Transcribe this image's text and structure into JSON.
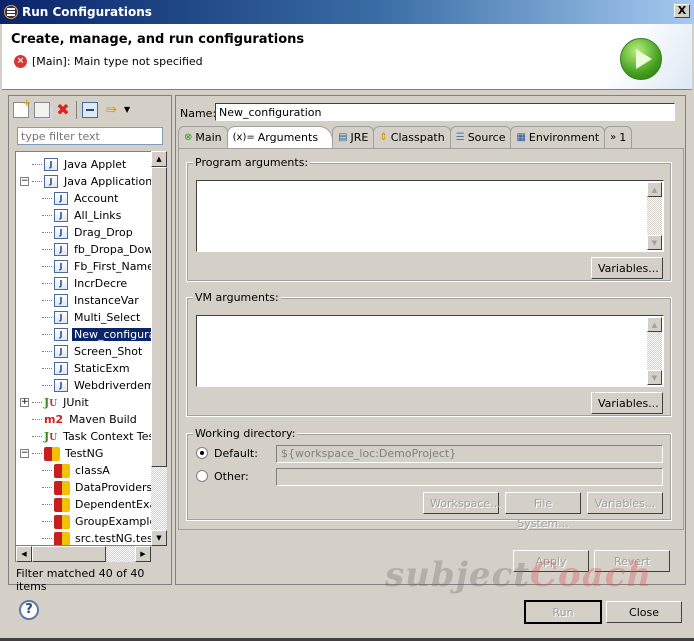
{
  "window": {
    "title": "Run Configurations",
    "close_label": "X"
  },
  "header": {
    "title": "Create, manage, and run configurations",
    "message": "[Main]: Main type not specified",
    "message_icon": "error-icon",
    "banner_icon": "run-icon"
  },
  "left": {
    "toolbar": [
      {
        "name": "new-launch-configuration",
        "icon": "new-icon"
      },
      {
        "name": "duplicate",
        "icon": "duplicate-icon"
      },
      {
        "name": "delete",
        "icon": "delete-icon"
      },
      {
        "name": "collapse-all",
        "icon": "collapse-all-icon"
      },
      {
        "name": "filter",
        "icon": "filter-icon"
      },
      {
        "name": "view-menu",
        "icon": "dropdown-icon"
      }
    ],
    "filter_placeholder": "type filter text",
    "tree": [
      {
        "label": "Java Applet",
        "icon": "java-applet-icon",
        "level": 0,
        "expander": ""
      },
      {
        "label": "Java Application",
        "icon": "java-app-icon",
        "level": 0,
        "expander": "−"
      },
      {
        "label": "Account",
        "icon": "java-app-icon",
        "level": 1
      },
      {
        "label": "All_Links",
        "icon": "java-app-icon",
        "level": 1
      },
      {
        "label": "Drag_Drop",
        "icon": "java-app-icon",
        "level": 1
      },
      {
        "label": "fb_Dropa_Dow",
        "icon": "java-app-icon",
        "level": 1
      },
      {
        "label": "Fb_First_Name",
        "icon": "java-app-icon",
        "level": 1
      },
      {
        "label": "IncrDecre",
        "icon": "java-app-icon",
        "level": 1
      },
      {
        "label": "InstanceVar",
        "icon": "java-app-icon",
        "level": 1
      },
      {
        "label": "Multi_Select",
        "icon": "java-app-icon",
        "level": 1
      },
      {
        "label": "New_configura",
        "icon": "java-app-icon",
        "level": 1,
        "selected": true
      },
      {
        "label": "Screen_Shot",
        "icon": "java-app-icon",
        "level": 1
      },
      {
        "label": "StaticExm",
        "icon": "java-app-icon",
        "level": 1
      },
      {
        "label": "Webdriverdem",
        "icon": "java-app-icon",
        "level": 1
      },
      {
        "label": "JUnit",
        "icon": "junit-icon",
        "level": 0,
        "expander": "+"
      },
      {
        "label": "Maven Build",
        "icon": "maven-icon",
        "level": 0
      },
      {
        "label": "Task Context Test",
        "icon": "task-context-icon",
        "level": 0
      },
      {
        "label": "TestNG",
        "icon": "testng-icon",
        "level": 0,
        "expander": "−"
      },
      {
        "label": "classA",
        "icon": "testng-icon",
        "level": 1
      },
      {
        "label": "DataProviders",
        "icon": "testng-icon",
        "level": 1
      },
      {
        "label": "DependentExa",
        "icon": "testng-icon",
        "level": 1
      },
      {
        "label": "GroupExample",
        "icon": "testng-icon",
        "level": 1
      },
      {
        "label": "src.testNG.tes",
        "icon": "testng-icon",
        "level": 1
      }
    ],
    "filter_status": "Filter matched 40 of 40 items"
  },
  "right": {
    "name_label": "Name:",
    "name_value": "New_configuration",
    "tabs": [
      {
        "label": "Main",
        "icon": "main-error-icon",
        "glyph": "⊗"
      },
      {
        "label": "Arguments",
        "icon": "arguments-icon",
        "glyph": "(x)=",
        "active": true
      },
      {
        "label": "JRE",
        "icon": "jre-icon",
        "glyph": "▤"
      },
      {
        "label": "Classpath",
        "icon": "classpath-icon",
        "glyph": "⇕"
      },
      {
        "label": "Source",
        "icon": "source-icon",
        "glyph": "☰"
      },
      {
        "label": "Environment",
        "icon": "environment-icon",
        "glyph": "▦"
      },
      {
        "label": "1",
        "icon": "more-tabs-icon",
        "glyph": "»"
      }
    ],
    "program_args": {
      "label": "Program arguments:",
      "value": "",
      "variables_label": "Variables..."
    },
    "vm_args": {
      "label": "VM arguments:",
      "value": "",
      "variables_label": "Variables..."
    },
    "working_dir": {
      "label": "Working directory:",
      "default_label": "Default:",
      "default_value": "${workspace_loc:DemoProject}",
      "default_selected": true,
      "other_label": "Other:",
      "other_value": "",
      "workspace_label": "Workspace...",
      "filesystem_label": "File System...",
      "variables_label": "Variables..."
    },
    "apply_label": "Apply",
    "revert_label": "Revert"
  },
  "footer": {
    "run_label": "Run",
    "close_label": "Close",
    "help_glyph": "?"
  },
  "watermark": {
    "part1": "subject",
    "part2": "Coach"
  }
}
